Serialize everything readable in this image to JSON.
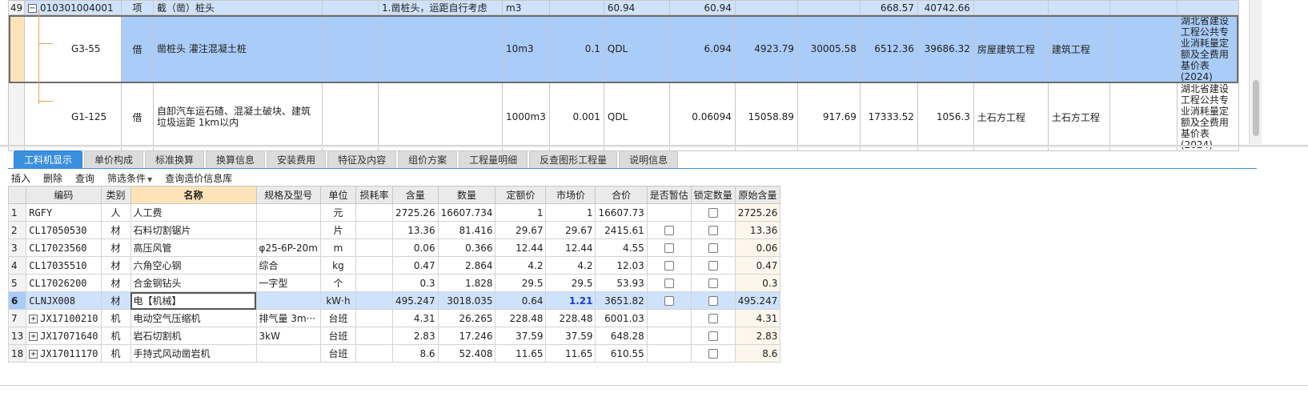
{
  "top_grid": {
    "rows": [
      {
        "rownum": "49",
        "code": "010301004001",
        "type": "项",
        "name": "截（凿）桩头",
        "spec": "",
        "feature": "1.凿桩头，运距自行考虑",
        "unit": "m3",
        "qty_expr": "",
        "qty_code": "60.94",
        "qty": "60.94",
        "c1": "",
        "c2": "",
        "c3": "668.57",
        "c4": "40742.66",
        "major1": "",
        "major2": "",
        "extra": "",
        "library": ""
      },
      {
        "rownum": "",
        "code": "G3-55",
        "type": "借",
        "name": "凿桩头 灌注混凝土桩",
        "spec": "",
        "feature": "",
        "unit": "10m3",
        "qty_expr": "0.1",
        "qty_code": "QDL",
        "qty": "6.094",
        "c1": "4923.79",
        "c2": "30005.58",
        "c3": "6512.36",
        "c4": "39686.32",
        "major1": "房屋建筑工程",
        "major2": "建筑工程",
        "extra": "",
        "library": "湖北省建设工程公共专业消耗量定额及全费用基价表(2024)"
      },
      {
        "rownum": "",
        "code": "G1-125",
        "type": "借",
        "name": "自卸汽车运石碴、混凝土破块、建筑垃圾运距 1km以内",
        "spec": "",
        "feature": "",
        "unit": "1000m3",
        "qty_expr": "0.001",
        "qty_code": "QDL",
        "qty": "0.06094",
        "c1": "15058.89",
        "c2": "917.69",
        "c3": "17333.52",
        "c4": "1056.3",
        "major1": "土石方工程",
        "major2": "土石方工程",
        "extra": "",
        "library": "湖北省建设工程公共专业消耗量定额及全费用基价表(2024)"
      }
    ]
  },
  "tabs": [
    "工料机显示",
    "单价构成",
    "标准换算",
    "换算信息",
    "安装费用",
    "特征及内容",
    "组价方案",
    "工程量明细",
    "反查图形工程量",
    "说明信息"
  ],
  "toolbar": {
    "insert": "插入",
    "delete": "删除",
    "query": "查询",
    "filter": "筛选条件",
    "price_lib": "查询造价信息库"
  },
  "bottom_grid": {
    "headers": [
      "",
      "编码",
      "类别",
      "名称",
      "规格及型号",
      "单位",
      "损耗率",
      "含量",
      "数量",
      "定额价",
      "市场价",
      "合价",
      "是否暂估",
      "锁定数量",
      "原始含量"
    ],
    "rows": [
      {
        "rn": "1",
        "expand": false,
        "code": "RGFY",
        "cat": "人",
        "name": "人工费",
        "spec": "",
        "unit": "元",
        "loss": "",
        "content": "2725.26",
        "qty": "16607.734",
        "quota": "1",
        "market": "1",
        "total": "16607.73",
        "est": false,
        "lock": true,
        "orig": "2725.26"
      },
      {
        "rn": "2",
        "expand": false,
        "code": "CL17050530",
        "cat": "材",
        "name": "石料切割锯片",
        "spec": "",
        "unit": "片",
        "loss": "",
        "content": "13.36",
        "qty": "81.416",
        "quota": "29.67",
        "market": "29.67",
        "total": "2415.61",
        "est": true,
        "lock": true,
        "orig": "13.36"
      },
      {
        "rn": "3",
        "expand": false,
        "code": "CL17023560",
        "cat": "材",
        "name": "高压风管",
        "spec": "φ25-6P-20m",
        "unit": "m",
        "loss": "",
        "content": "0.06",
        "qty": "0.366",
        "quota": "12.44",
        "market": "12.44",
        "total": "4.55",
        "est": true,
        "lock": true,
        "orig": "0.06"
      },
      {
        "rn": "4",
        "expand": false,
        "code": "CL17035510",
        "cat": "材",
        "name": "六角空心钢",
        "spec": "综合",
        "unit": "kg",
        "loss": "",
        "content": "0.47",
        "qty": "2.864",
        "quota": "4.2",
        "market": "4.2",
        "total": "12.03",
        "est": true,
        "lock": true,
        "orig": "0.47"
      },
      {
        "rn": "5",
        "expand": false,
        "code": "CL17026200",
        "cat": "材",
        "name": "合金钢钻头",
        "spec": "一字型",
        "unit": "个",
        "loss": "",
        "content": "0.3",
        "qty": "1.828",
        "quota": "29.5",
        "market": "29.5",
        "total": "53.93",
        "est": true,
        "lock": true,
        "orig": "0.3"
      },
      {
        "rn": "6",
        "expand": false,
        "code": "CLNJX008",
        "cat": "材",
        "name": "电【机械】",
        "spec": "",
        "unit": "kW·h",
        "loss": "",
        "content": "495.247",
        "qty": "3018.035",
        "quota": "0.64",
        "market": "1.21",
        "total": "3651.82",
        "est": true,
        "lock": true,
        "orig": "495.247",
        "selected": true
      },
      {
        "rn": "7",
        "expand": true,
        "code": "JX17100210",
        "cat": "机",
        "name": "电动空气压缩机",
        "spec": "排气量 3m···",
        "unit": "台班",
        "loss": "",
        "content": "4.31",
        "qty": "26.265",
        "quota": "228.48",
        "market": "228.48",
        "total": "6001.03",
        "est": false,
        "lock": true,
        "orig": "4.31"
      },
      {
        "rn": "13",
        "expand": true,
        "code": "JX17071640",
        "cat": "机",
        "name": "岩石切割机",
        "spec": "3kW",
        "unit": "台班",
        "loss": "",
        "content": "2.83",
        "qty": "17.246",
        "quota": "37.59",
        "market": "37.59",
        "total": "648.28",
        "est": false,
        "lock": true,
        "orig": "2.83"
      },
      {
        "rn": "18",
        "expand": true,
        "code": "JX17011170",
        "cat": "机",
        "name": "手持式风动凿岩机",
        "spec": "",
        "unit": "台班",
        "loss": "",
        "content": "8.6",
        "qty": "52.408",
        "quota": "11.65",
        "market": "11.65",
        "total": "610.55",
        "est": false,
        "lock": true,
        "orig": "8.6"
      }
    ]
  }
}
